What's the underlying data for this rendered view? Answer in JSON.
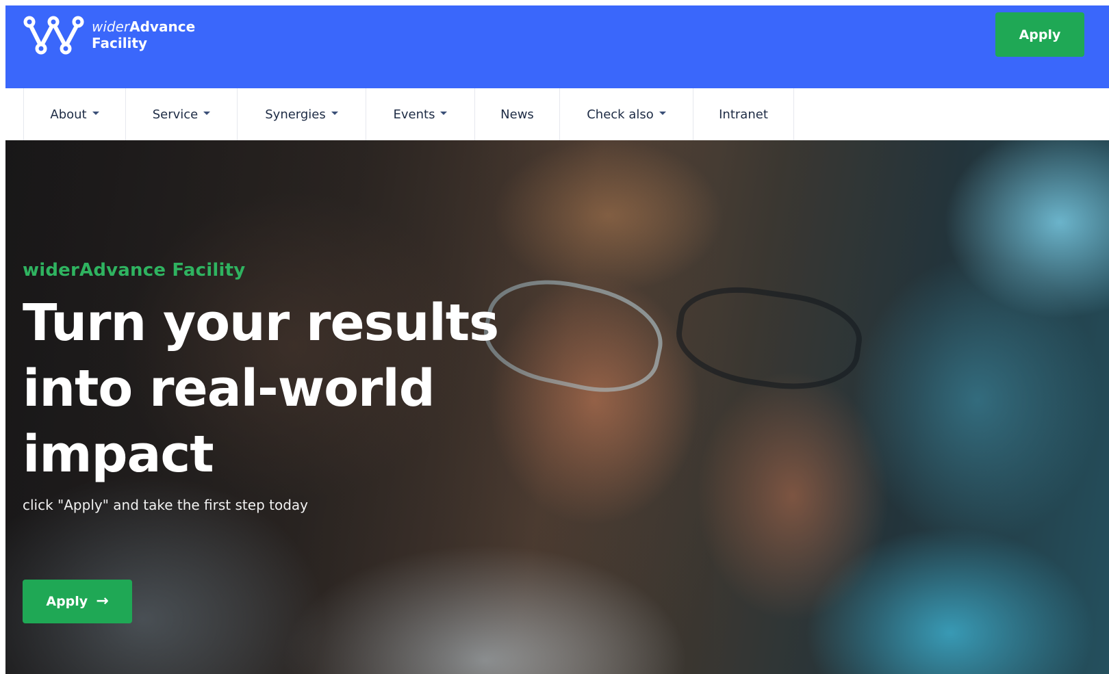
{
  "header": {
    "logo": {
      "name_light": "wider",
      "name_bold": "Advance",
      "line2": "Facility"
    },
    "apply_label": "Apply",
    "brand_color": "#3a67fb",
    "accent_color": "#1fa855"
  },
  "nav": {
    "items": [
      {
        "label": "About",
        "dropdown": true
      },
      {
        "label": "Service",
        "dropdown": true
      },
      {
        "label": "Synergies",
        "dropdown": true
      },
      {
        "label": "Events",
        "dropdown": true
      },
      {
        "label": "News",
        "dropdown": false
      },
      {
        "label": "Check also",
        "dropdown": true
      },
      {
        "label": "Intranet",
        "dropdown": false
      }
    ]
  },
  "hero": {
    "eyebrow": "widerAdvance Facility",
    "headline": [
      "Turn your results",
      "into real-world",
      "impact"
    ],
    "subline": "click \"Apply\" and take the first step today",
    "apply_label": "Apply",
    "apply_icon": "arrow-right-icon"
  }
}
